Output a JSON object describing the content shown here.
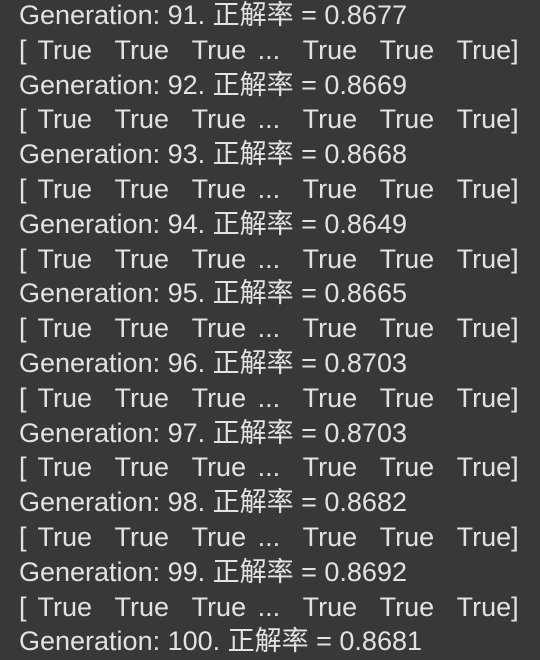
{
  "output": {
    "lines": [
      {
        "generation": "Generation: 91. 正解率 = 0.8677",
        "array": "[ True  True  True ...  True  True  True]"
      },
      {
        "generation": "Generation: 92. 正解率 = 0.8669",
        "array": "[ True  True  True ...  True  True  True]"
      },
      {
        "generation": "Generation: 93. 正解率 = 0.8668",
        "array": "[ True  True  True ...  True  True  True]"
      },
      {
        "generation": "Generation: 94. 正解率 = 0.8649",
        "array": "[ True  True  True ...  True  True  True]"
      },
      {
        "generation": "Generation: 95. 正解率 = 0.8665",
        "array": "[ True  True  True ...  True  True  True]"
      },
      {
        "generation": "Generation: 96. 正解率 = 0.8703",
        "array": "[ True  True  True ...  True  True  True]"
      },
      {
        "generation": "Generation: 97. 正解率 = 0.8703",
        "array": "[ True  True  True ...  True  True  True]"
      },
      {
        "generation": "Generation: 98. 正解率 = 0.8682",
        "array": "[ True  True  True ...  True  True  True]"
      },
      {
        "generation": "Generation: 99. 正解率 = 0.8692",
        "array": "[ True  True  True ...  True  True  True]"
      },
      {
        "generation": "Generation: 100. 正解率 = 0.8681"
      }
    ]
  },
  "colors": {
    "background": "#383838",
    "text": "#e2e2e2"
  }
}
